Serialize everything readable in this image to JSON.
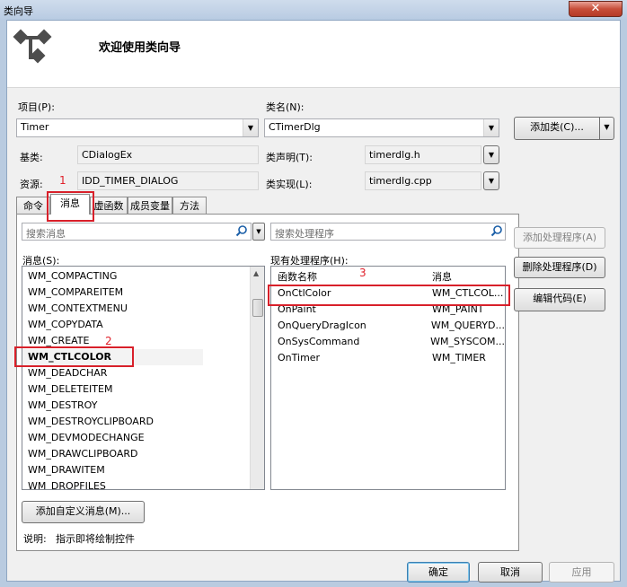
{
  "window": {
    "title": "类向导",
    "close_glyph": "✕"
  },
  "banner": {
    "heading": "欢迎使用类向导"
  },
  "fields": {
    "project_label": "项目(P):",
    "project_value": "Timer",
    "classname_label": "类名(N):",
    "classname_value": "CTimerDlg",
    "add_class_label": "添加类(C)...",
    "base_label": "基类:",
    "base_value": "CDialogEx",
    "decl_label": "类声明(T):",
    "decl_value": "timerdlg.h",
    "resource_label": "资源:",
    "resource_value": "IDD_TIMER_DIALOG",
    "impl_label": "类实现(L):",
    "impl_value": "timerdlg.cpp"
  },
  "tabs": [
    "命令",
    "消息",
    "虚函数",
    "成员变量",
    "方法"
  ],
  "messages": {
    "search_placeholder": "搜索消息",
    "list_label": "消息(S):",
    "items": [
      "WM_COMPACTING",
      "WM_COMPAREITEM",
      "WM_CONTEXTMENU",
      "WM_COPYDATA",
      "WM_CREATE",
      "WM_CTLCOLOR",
      "WM_DEADCHAR",
      "WM_DELETEITEM",
      "WM_DESTROY",
      "WM_DESTROYCLIPBOARD",
      "WM_DEVMODECHANGE",
      "WM_DRAWCLIPBOARD",
      "WM_DRAWITEM",
      "WM_DROPFILES"
    ],
    "add_custom_label": "添加自定义消息(M)..."
  },
  "handlers": {
    "search_placeholder": "搜索处理程序",
    "list_label": "现有处理程序(H):",
    "col_func": "函数名称",
    "col_msg": "消息",
    "rows": [
      {
        "func": "OnCtlColor",
        "msg": "WM_CTLCOL..."
      },
      {
        "func": "OnPaint",
        "msg": "WM_PAINT"
      },
      {
        "func": "OnQueryDragIcon",
        "msg": "WM_QUERYD..."
      },
      {
        "func": "OnSysCommand",
        "msg": "WM_SYSCOM..."
      },
      {
        "func": "OnTimer",
        "msg": "WM_TIMER"
      }
    ]
  },
  "side_buttons": {
    "add_handler": "添加处理程序(A)",
    "delete_handler": "删除处理程序(D)",
    "edit_code": "编辑代码(E)"
  },
  "description": {
    "label": "说明:",
    "text": "指示即将绘制控件"
  },
  "footer": {
    "ok": "确定",
    "cancel": "取消",
    "apply": "应用"
  },
  "annotations": {
    "n1": "1",
    "n2": "2",
    "n3": "3"
  }
}
